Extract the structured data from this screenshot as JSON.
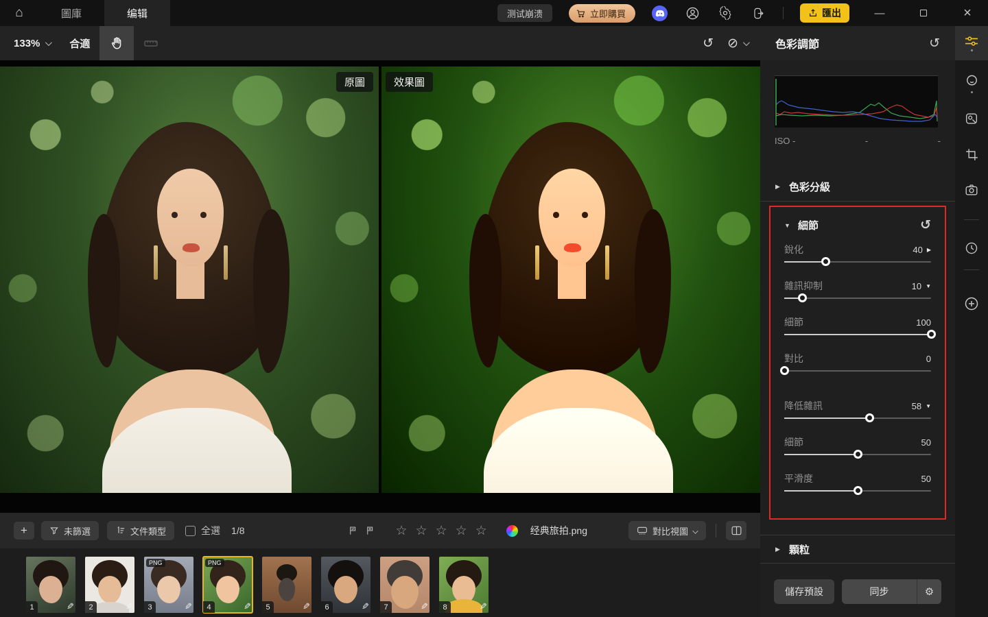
{
  "colors": {
    "accent_yellow": "#f2c21b",
    "highlight_red": "#e02a21",
    "discord_blue": "#5865f2",
    "selected_thumb_border": "#e9b322"
  },
  "icons": {
    "home": "⌂",
    "reset": "↺",
    "compare_off": "⊘",
    "triangle_right": "▶",
    "triangle_down": "▼",
    "star": "☆",
    "pencil": "✎",
    "plus": "+",
    "minimize": "—",
    "close": "×",
    "gear": "⚙"
  },
  "titlebar": {
    "tab_library": "圖庫",
    "tab_edit": "编辑",
    "test_button": "测试崩溃",
    "buy_button": "立即購買",
    "export_button": "匯出"
  },
  "toolbar": {
    "zoom_level": "133%",
    "fit_button": "合適"
  },
  "canvas": {
    "original_label": "原圖",
    "effect_label": "效果圖"
  },
  "right_panel": {
    "title": "色彩調節",
    "iso_label": "ISO -",
    "aperture_value": "-",
    "shutter_value": "-",
    "color_grading_section": "色彩分級",
    "detail_section": "細節",
    "grain_section": "顆粒",
    "sliders": [
      {
        "label": "銳化",
        "value": "40",
        "pct": 28,
        "arrow": "▶"
      },
      {
        "label": "雜訊抑制",
        "value": "10",
        "pct": 12,
        "arrow": "▼"
      },
      {
        "label": "細節",
        "value": "100",
        "pct": 100,
        "arrow": ""
      },
      {
        "label": "對比",
        "value": "0",
        "pct": 0,
        "arrow": ""
      },
      {
        "label": "降低雜訊",
        "value": "58",
        "pct": 58,
        "arrow": "▼"
      },
      {
        "label": "細節",
        "value": "50",
        "pct": 50,
        "arrow": ""
      },
      {
        "label": "平滑度",
        "value": "50",
        "pct": 50,
        "arrow": ""
      }
    ],
    "save_preset_button": "儲存預設",
    "sync_button": "同步"
  },
  "bottom_bar": {
    "filter_button": "未篩選",
    "file_type_button": "文件類型",
    "select_all_label": "全選",
    "count": "1/8",
    "filename": "经典旅拍.png",
    "compare_view_button": "對比視圖"
  },
  "filmstrip": {
    "items": [
      {
        "index": "1",
        "badge": ""
      },
      {
        "index": "2",
        "badge": ""
      },
      {
        "index": "3",
        "badge": "PNG"
      },
      {
        "index": "4",
        "badge": "PNG"
      },
      {
        "index": "5",
        "badge": ""
      },
      {
        "index": "6",
        "badge": ""
      },
      {
        "index": "7",
        "badge": ""
      },
      {
        "index": "8",
        "badge": ""
      }
    ]
  }
}
